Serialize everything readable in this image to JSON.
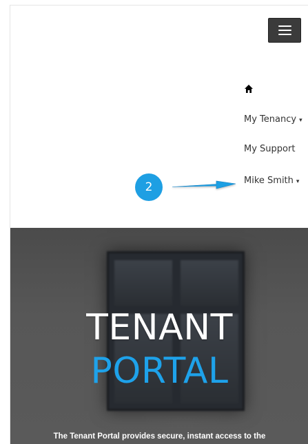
{
  "header": {
    "menu_toggle_icon": "hamburger-menu-icon"
  },
  "nav": {
    "home_icon": "home-icon",
    "items": [
      {
        "label": "My Tenancy",
        "has_dropdown": true
      },
      {
        "label": "My Support",
        "has_dropdown": false
      },
      {
        "label": "Mike Smith",
        "has_dropdown": true
      }
    ],
    "caret": "▾"
  },
  "annotation": {
    "step_number": "2",
    "step_color": "#1e9fe3",
    "arrow_icon": "arrow-right-icon"
  },
  "hero": {
    "title_line1": "TENANT",
    "title_line2": "PORTAL",
    "title_line2_color": "#1ea2ea",
    "description": "The Tenant Portal provides secure, instant access to the"
  }
}
